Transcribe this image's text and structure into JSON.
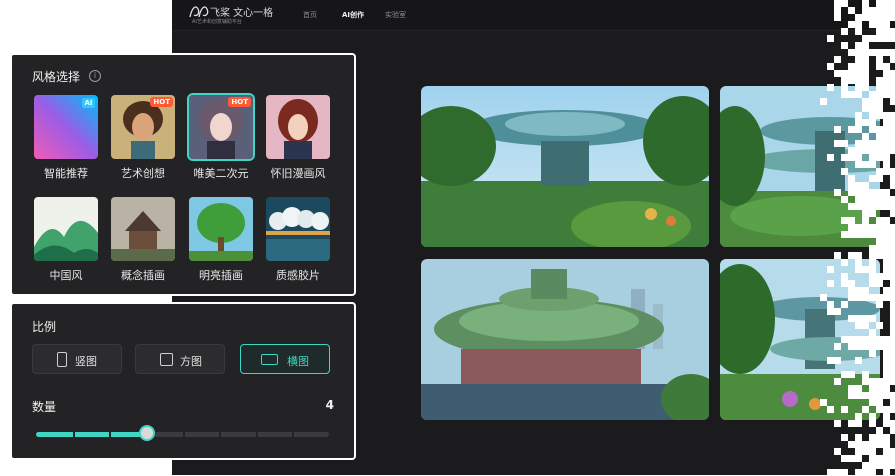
{
  "header": {
    "logo_text": "飞桨 文心一格",
    "logo_sub": "AI艺术和创意辅助平台",
    "nav": [
      "首页",
      "AI创作",
      "实验室"
    ],
    "active_nav": "AI创作"
  },
  "style_panel": {
    "title": "风格选择",
    "info_icon": "info-icon",
    "styles": [
      {
        "label": "智能推荐",
        "badge": "AI",
        "selected": false
      },
      {
        "label": "艺术创想",
        "badge": "HOT",
        "selected": false
      },
      {
        "label": "唯美二次元",
        "badge": "HOT",
        "selected": true
      },
      {
        "label": "怀旧漫画风",
        "badge": "",
        "selected": false
      },
      {
        "label": "中国风",
        "badge": "",
        "selected": false
      },
      {
        "label": "概念插画",
        "badge": "",
        "selected": false
      },
      {
        "label": "明亮插画",
        "badge": "",
        "selected": false
      },
      {
        "label": "质感胶片",
        "badge": "",
        "selected": false
      }
    ]
  },
  "ratio_panel": {
    "title": "比例",
    "options": [
      {
        "label": "竖图",
        "icon": "portrait-ratio-icon",
        "selected": false
      },
      {
        "label": "方图",
        "icon": "square-ratio-icon",
        "selected": false
      },
      {
        "label": "横图",
        "icon": "landscape-ratio-icon",
        "selected": true
      }
    ],
    "quantity_label": "数量",
    "quantity_value": "4",
    "quantity_min": 1,
    "quantity_max": 10,
    "quantity_fraction": 0.38
  },
  "colors": {
    "accent": "#3fd6c6",
    "hot_badge": "#ff5a36",
    "ai_badge": "#2ec7ff",
    "panel_bg": "#232325",
    "app_bg": "#1b1b1d"
  }
}
